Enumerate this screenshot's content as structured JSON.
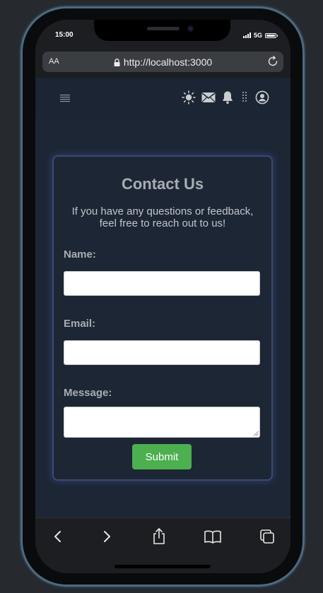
{
  "status_bar": {
    "time": "15:00",
    "network": "5G"
  },
  "browser": {
    "text_size_label": "AA",
    "url": "http://localhost:3000"
  },
  "header": {
    "icons": [
      "menu-icon",
      "sun-icon",
      "mail-icon",
      "bell-icon",
      "apps-icon",
      "user-icon"
    ]
  },
  "contact_form": {
    "title": "Contact Us",
    "description": "If you have any questions or feedback, feel free to reach out to us!",
    "name_label": "Name:",
    "name_value": "",
    "email_label": "Email:",
    "email_value": "",
    "message_label": "Message:",
    "message_value": "",
    "submit_label": "Submit"
  },
  "colors": {
    "background": "#1d2634",
    "card_border": "#3b4a72",
    "submit": "#4caf50",
    "label": "#a9adb3"
  },
  "bottom_toolbar": {
    "icons": [
      "back-icon",
      "forward-icon",
      "share-icon",
      "bookmarks-icon",
      "tabs-icon"
    ]
  }
}
